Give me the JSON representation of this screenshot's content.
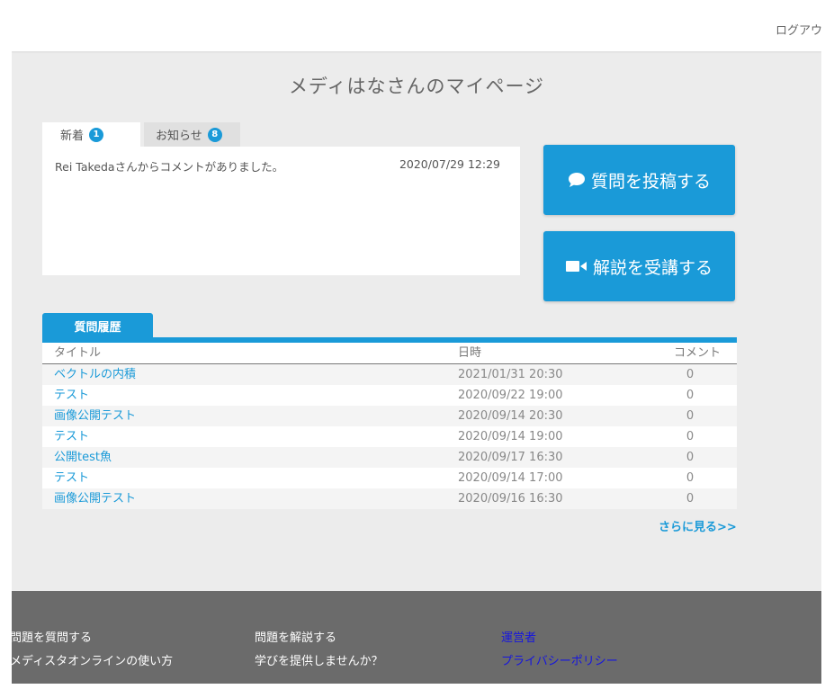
{
  "header": {
    "logout": "ログアウト"
  },
  "page_title": "メディはなさんのマイページ",
  "tabs": [
    {
      "label": "新着",
      "count": "1"
    },
    {
      "label": "お知らせ",
      "count": "8"
    }
  ],
  "news": [
    {
      "text": "Rei Takedaさんからコメントがありました。",
      "date": "2020/07/29 12:29"
    }
  ],
  "buttons": {
    "post_question": "質問を投稿する",
    "take_lecture": "解説を受講する"
  },
  "history": {
    "tab_label": "質問履歴",
    "columns": [
      "タイトル",
      "日時",
      "コメント"
    ],
    "rows": [
      {
        "title": "ベクトルの内積",
        "date": "2021/01/31 20:30",
        "comments": "0"
      },
      {
        "title": "テスト",
        "date": "2020/09/22 19:00",
        "comments": "0"
      },
      {
        "title": "画像公開テスト",
        "date": "2020/09/14 20:30",
        "comments": "0"
      },
      {
        "title": "テスト",
        "date": "2020/09/14 19:00",
        "comments": "0"
      },
      {
        "title": "公開test魚",
        "date": "2020/09/17 16:30",
        "comments": "0"
      },
      {
        "title": "テスト",
        "date": "2020/09/14 17:00",
        "comments": "0"
      },
      {
        "title": "画像公開テスト",
        "date": "2020/09/16 16:30",
        "comments": "0"
      }
    ],
    "more_link": "さらに見る>>"
  },
  "footer": {
    "col1": [
      "問題を質問する",
      "メディスタオンラインの使い方"
    ],
    "col2": [
      "問題を解説する",
      "学びを提供しませんか？"
    ],
    "col3": [
      "運営者",
      "プライバシーポリシー"
    ]
  },
  "colors": {
    "accent": "#1a9ad8",
    "footer_bg": "#6b6b6b",
    "footer_link": "#1515e0"
  }
}
